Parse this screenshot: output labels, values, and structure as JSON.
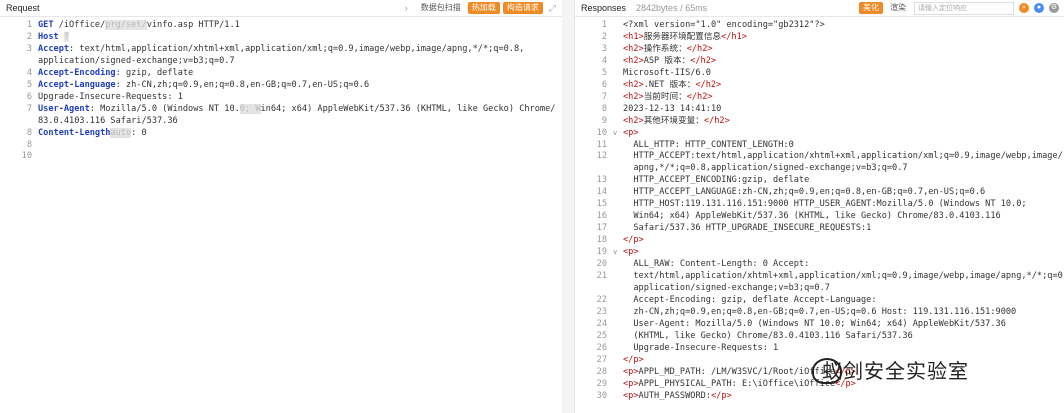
{
  "request": {
    "title": "Request",
    "actions": {
      "scan": "数据包扫描",
      "hotload": "热加载",
      "build": "构造请求"
    },
    "lines": [
      {
        "n": "1",
        "parts": [
          {
            "t": "GET",
            "c": "k"
          },
          {
            "t": " /iOffice/",
            "c": "m"
          },
          {
            "t": "prg/set/",
            "c": "blur"
          },
          {
            "t": "vinfo.asp HTTP/1.1",
            "c": "m"
          }
        ]
      },
      {
        "n": "2",
        "parts": [
          {
            "t": "Host",
            "c": "k"
          },
          {
            "t": " ",
            "c": "m"
          },
          {
            "t": "?",
            "c": "blur"
          }
        ]
      },
      {
        "n": "3",
        "parts": [
          {
            "t": "Accept",
            "c": "k"
          },
          {
            "t": ": text/html,application/xhtml+xml,application/xml;q=0.9,image/webp,image/apng,*/*;q=0.8,",
            "c": "m"
          }
        ]
      },
      {
        "n": "",
        "parts": [
          {
            "t": "application/signed-exchange;v=b3;q=0.7",
            "c": "m"
          }
        ]
      },
      {
        "n": "4",
        "parts": [
          {
            "t": "Accept-Encoding",
            "c": "k"
          },
          {
            "t": ": gzip, deflate",
            "c": "m"
          }
        ]
      },
      {
        "n": "5",
        "parts": [
          {
            "t": "Accept-Language",
            "c": "k"
          },
          {
            "t": ": zh-CN,zh;q=0.9,en;q=0.8,en-GB;q=0.7,en-US;q=0.6",
            "c": "m"
          }
        ]
      },
      {
        "n": "6",
        "parts": [
          {
            "t": "Upgrade-Insecure-Requests: 1",
            "c": "m"
          }
        ]
      },
      {
        "n": "7",
        "parts": [
          {
            "t": "User-Agent",
            "c": "k"
          },
          {
            "t": ": Mozilla/5.0 (Windows NT 10.",
            "c": "m"
          },
          {
            "t": "0; W",
            "c": "blur"
          },
          {
            "t": "in64; x64) AppleWebKit/537.36 (KHTML, like Gecko) Chrome/",
            "c": "m"
          }
        ]
      },
      {
        "n": "",
        "parts": [
          {
            "t": "83.0.4103.116 Safari/537.36",
            "c": "m"
          }
        ]
      },
      {
        "n": "8",
        "parts": [
          {
            "t": "Content-Length",
            "c": "k"
          },
          {
            "t": "auto",
            "c": "blur"
          },
          {
            "t": ": 0",
            "c": "m"
          }
        ]
      },
      {
        "n": "8",
        "parts": []
      },
      {
        "n": "10",
        "parts": []
      }
    ]
  },
  "response": {
    "title": "Responses",
    "meta": "2842bytes / 65ms",
    "actions": {
      "beautify": "美化",
      "render": "渲染"
    },
    "search_placeholder": "请输入定位响应",
    "lines": [
      {
        "n": "1",
        "f": "",
        "parts": [
          {
            "t": "<?xml version=\"1.0\" encoding=\"gb2312\"?>",
            "c": "m"
          }
        ]
      },
      {
        "n": "2",
        "f": "",
        "parts": [
          {
            "t": "<h1>",
            "c": "tag"
          },
          {
            "t": "服务器环境配置信息",
            "c": "m"
          },
          {
            "t": "</h1>",
            "c": "tag"
          }
        ]
      },
      {
        "n": "3",
        "f": "",
        "parts": [
          {
            "t": "<h2>",
            "c": "tag"
          },
          {
            "t": "操作系统：",
            "c": "m"
          },
          {
            "t": "</h2>",
            "c": "tag"
          }
        ]
      },
      {
        "n": "4",
        "f": "",
        "parts": [
          {
            "t": "<h2>",
            "c": "tag"
          },
          {
            "t": "ASP 版本：",
            "c": "m"
          },
          {
            "t": "</h2>",
            "c": "tag"
          }
        ]
      },
      {
        "n": "5",
        "f": "",
        "parts": [
          {
            "t": "Microsoft-IIS/6.0",
            "c": "m"
          }
        ]
      },
      {
        "n": "6",
        "f": "",
        "parts": [
          {
            "t": "<h2>",
            "c": "tag"
          },
          {
            "t": ".NET 版本：",
            "c": "m"
          },
          {
            "t": "</h2>",
            "c": "tag"
          }
        ]
      },
      {
        "n": "7",
        "f": "",
        "parts": [
          {
            "t": "<h2>",
            "c": "tag"
          },
          {
            "t": "当前时间：",
            "c": "m"
          },
          {
            "t": "</h2>",
            "c": "tag"
          }
        ]
      },
      {
        "n": "8",
        "f": "",
        "parts": [
          {
            "t": "2023-12-13 14:41:10",
            "c": "m"
          }
        ]
      },
      {
        "n": "9",
        "f": "",
        "parts": [
          {
            "t": "<h2>",
            "c": "tag"
          },
          {
            "t": "其他环境变量：",
            "c": "m"
          },
          {
            "t": "</h2>",
            "c": "tag"
          }
        ]
      },
      {
        "n": "10",
        "f": "v",
        "parts": [
          {
            "t": "<p>",
            "c": "tag"
          }
        ]
      },
      {
        "n": "11",
        "f": "",
        "parts": [
          {
            "t": "  ALL_HTTP: HTTP_CONTENT_LENGTH:0",
            "c": "m"
          }
        ]
      },
      {
        "n": "12",
        "f": "",
        "parts": [
          {
            "t": "  HTTP_ACCEPT:text/html,application/xhtml+xml,application/xml;q=0.9,image/webp,image/",
            "c": "m"
          }
        ]
      },
      {
        "n": "",
        "f": "",
        "parts": [
          {
            "t": "  apng,*/*;q=0.8,application/signed-exchange;v=b3;q=0.7",
            "c": "m"
          }
        ]
      },
      {
        "n": "13",
        "f": "",
        "parts": [
          {
            "t": "  HTTP_ACCEPT_ENCODING:gzip, deflate",
            "c": "m"
          }
        ]
      },
      {
        "n": "14",
        "f": "",
        "parts": [
          {
            "t": "  HTTP_ACCEPT_LANGUAGE:zh-CN,zh;q=0.9,en;q=0.8,en-GB;q=0.7,en-US;q=0.6",
            "c": "m"
          }
        ]
      },
      {
        "n": "15",
        "f": "",
        "parts": [
          {
            "t": "  HTTP_HOST:119.131.116.151:9000 HTTP_USER_AGENT:Mozilla/5.0 (Windows NT 10.0;",
            "c": "m"
          }
        ]
      },
      {
        "n": "16",
        "f": "",
        "parts": [
          {
            "t": "  Win64; x64) AppleWebKit/537.36 (KHTML, like Gecko) Chrome/83.0.4103.116",
            "c": "m"
          }
        ]
      },
      {
        "n": "17",
        "f": "",
        "parts": [
          {
            "t": "  Safari/537.36 HTTP_UPGRADE_INSECURE_REQUESTS:1",
            "c": "m"
          }
        ]
      },
      {
        "n": "18",
        "f": "",
        "parts": [
          {
            "t": "</p>",
            "c": "tag"
          }
        ]
      },
      {
        "n": "19",
        "f": "v",
        "parts": [
          {
            "t": "<p>",
            "c": "tag"
          }
        ]
      },
      {
        "n": "20",
        "f": "",
        "parts": [
          {
            "t": "  ALL_RAW: Content-Length: 0 Accept:",
            "c": "m"
          }
        ]
      },
      {
        "n": "21",
        "f": "",
        "parts": [
          {
            "t": "  text/html,application/xhtml+xml,application/xml;q=0.9,image/webp,image/apng,*/*;q=0.8,",
            "c": "m"
          }
        ]
      },
      {
        "n": "",
        "f": "",
        "parts": [
          {
            "t": "  application/signed-exchange;v=b3;q=0.7",
            "c": "m"
          }
        ]
      },
      {
        "n": "22",
        "f": "",
        "parts": [
          {
            "t": "  Accept-Encoding: gzip, deflate Accept-Language:",
            "c": "m"
          }
        ]
      },
      {
        "n": "23",
        "f": "",
        "parts": [
          {
            "t": "  zh-CN,zh;q=0.9,en;q=0.8,en-GB;q=0.7,en-US;q=0.6 Host: 119.131.116.151:9000",
            "c": "m"
          }
        ]
      },
      {
        "n": "24",
        "f": "",
        "parts": [
          {
            "t": "  User-Agent: Mozilla/5.0 (Windows NT 10.0; Win64; x64) AppleWebKit/537.36",
            "c": "m"
          }
        ]
      },
      {
        "n": "25",
        "f": "",
        "parts": [
          {
            "t": "  (KHTML, like Gecko) Chrome/83.0.4103.116 Safari/537.36",
            "c": "m"
          }
        ]
      },
      {
        "n": "26",
        "f": "",
        "parts": [
          {
            "t": "  Upgrade-Insecure-Requests: 1",
            "c": "m"
          }
        ]
      },
      {
        "n": "27",
        "f": "",
        "parts": [
          {
            "t": "</p>",
            "c": "tag"
          }
        ]
      },
      {
        "n": "28",
        "f": "",
        "parts": [
          {
            "t": "<p>",
            "c": "tag"
          },
          {
            "t": "APPL_MD_PATH: /LM/W3SVC/1/Root/iOffice",
            "c": "m"
          },
          {
            "t": "</p>",
            "c": "tag"
          }
        ]
      },
      {
        "n": "29",
        "f": "",
        "parts": [
          {
            "t": "<p>",
            "c": "tag"
          },
          {
            "t": "APPL_PHYSICAL_PATH: E:\\iOffice\\iOffice",
            "c": "m"
          },
          {
            "t": "</p>",
            "c": "tag"
          }
        ]
      },
      {
        "n": "30",
        "f": "",
        "parts": [
          {
            "t": "<p>",
            "c": "tag"
          },
          {
            "t": "AUTH_PASSWORD:",
            "c": "m"
          },
          {
            "t": "</p>",
            "c": "tag"
          }
        ]
      }
    ]
  },
  "watermark": "蚁剑安全实验室",
  "colors": {
    "orange": "#f08a24",
    "keyword": "#1f3fc0",
    "tag": "#b11111"
  }
}
